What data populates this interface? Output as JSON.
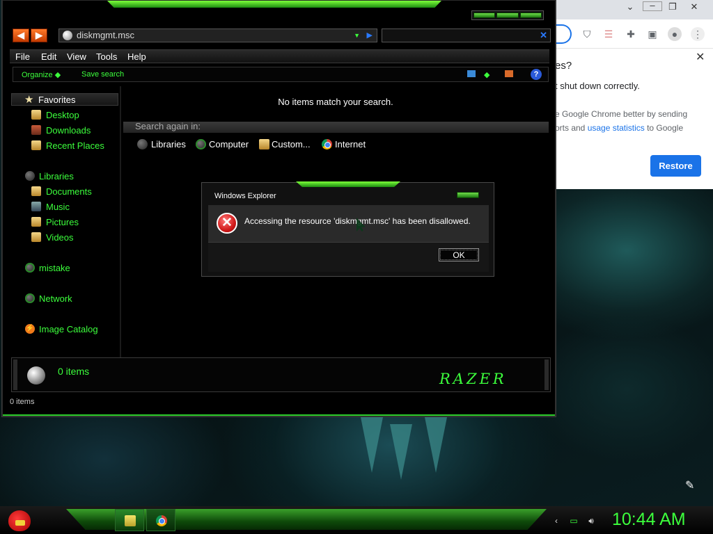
{
  "explorer": {
    "address": "diskmgmt.msc",
    "menu": [
      "File",
      "Edit",
      "View",
      "Tools",
      "Help"
    ],
    "commands": {
      "organize": "Organize",
      "save_search": "Save search"
    },
    "favorites_header": "Favorites",
    "nav": {
      "favorites": [
        "Desktop",
        "Downloads",
        "Recent Places"
      ],
      "libraries_header": "Libraries",
      "libraries": [
        "Documents",
        "Music",
        "Pictures",
        "Videos"
      ],
      "mistake": "mistake",
      "network": "Network",
      "image_catalog": "Image Catalog"
    },
    "content": {
      "no_items": "No items match your search.",
      "search_again": "Search again in:",
      "locations": [
        "Libraries",
        "Computer",
        "Custom...",
        "Internet"
      ]
    },
    "details": {
      "count": "0 items",
      "brand": "RAZER"
    },
    "status": "0 items"
  },
  "dialog": {
    "title": "Windows Explorer",
    "message": "Accessing the resource 'diskmgmt.msc' has been disallowed.",
    "ok": "OK"
  },
  "chrome": {
    "title": "es?",
    "subtitle": "t shut down correctly.",
    "body1": "e Google Chrome better by sending",
    "body2_prefix": "orts and ",
    "body2_link": "usage statistics",
    "body2_suffix": " to Google",
    "restore": "Restore",
    "toolbar_icons": [
      "ublock-icon",
      "translate-icon",
      "extensions-icon",
      "sidepanel-icon",
      "profile-icon",
      "menu-icon"
    ]
  },
  "taskbar": {
    "clock": "10:44 AM"
  },
  "colors": {
    "accent": "#3cff3c",
    "chrome_blue": "#1a73e8",
    "error_red": "#d11a1a"
  }
}
